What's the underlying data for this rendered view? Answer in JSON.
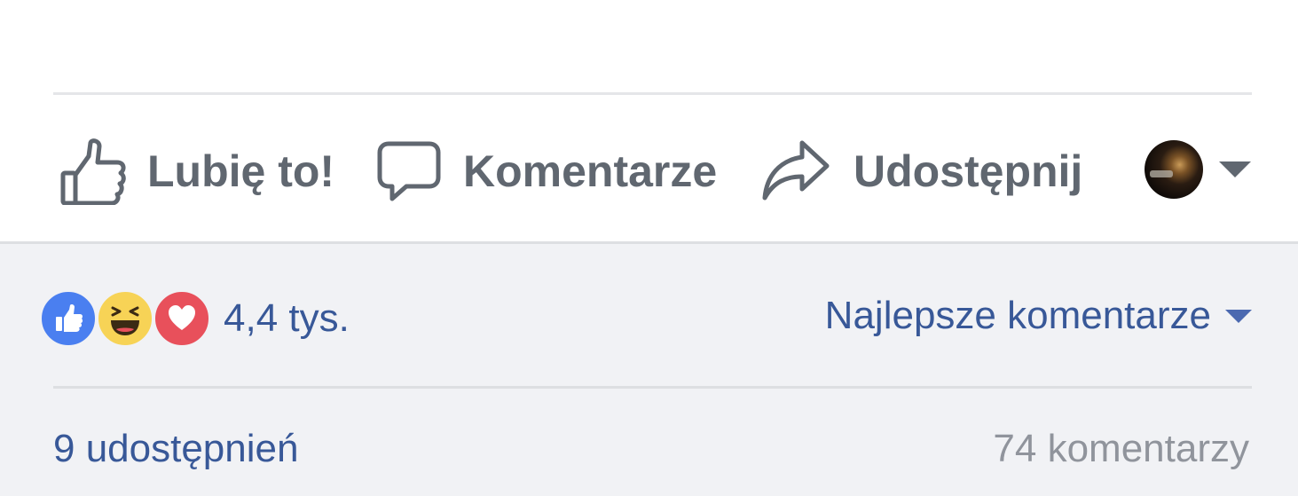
{
  "actions": {
    "like_label": "Lubię to!",
    "comment_label": "Komentarze",
    "share_label": "Udostępnij"
  },
  "reactions": {
    "types": [
      "like",
      "haha",
      "love"
    ],
    "count": "4,4 tys."
  },
  "sort": {
    "label": "Najlepsze komentarze"
  },
  "footer": {
    "shares": "9 udostępnień",
    "comments": "74 komentarzy"
  },
  "colors": {
    "action_text": "#606770",
    "link_blue": "#385898",
    "muted_text": "#90949c",
    "grey_background": "#f1f2f5",
    "like_reaction": "#4a7ff0",
    "haha_reaction": "#f7d356",
    "love_reaction": "#e8505b"
  },
  "icons": {
    "like": "thumbs-up-icon",
    "comment": "speech-bubble-icon",
    "share": "share-arrow-icon",
    "audience_caret": "caret-down-icon",
    "sort_caret": "caret-down-icon"
  }
}
